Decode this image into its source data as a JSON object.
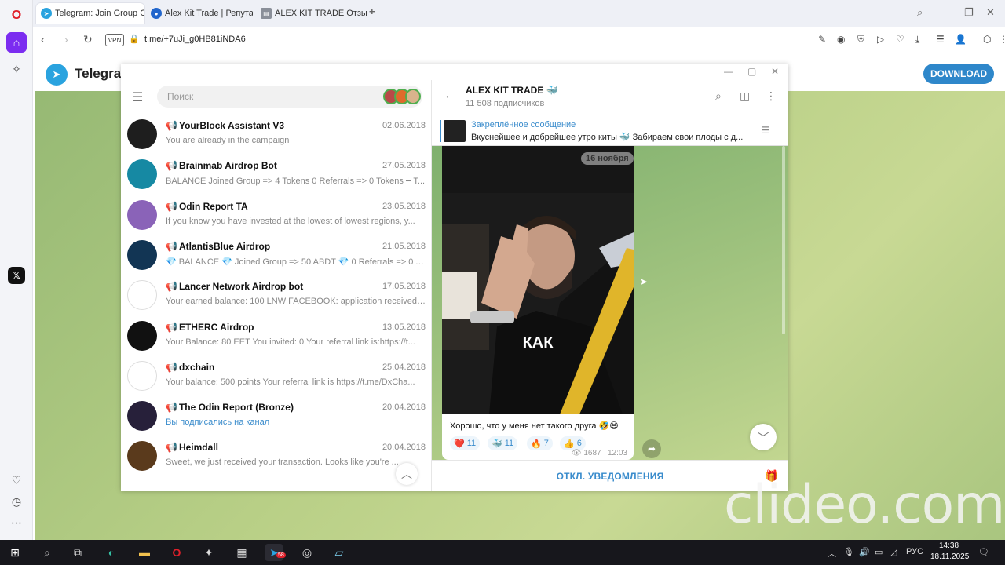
{
  "browser": {
    "tabs": [
      {
        "label": "Telegram: Join Group Chat",
        "icon": "telegram-icon",
        "active": true
      },
      {
        "label": "Alex Kit Trade | Репутация",
        "icon": "site-icon",
        "active": false
      },
      {
        "label": "ALEX KIT TRADE Отзывы",
        "icon": "document-icon",
        "active": false
      }
    ],
    "new_tab": "+",
    "url": "t.me/+7uJi_g0HB81iNDA6",
    "vpn_label": "VPN"
  },
  "tg_web": {
    "title": "Telegra",
    "download_label": "DOWNLOAD"
  },
  "left_panel": {
    "search_placeholder": "Поиск",
    "chats": [
      {
        "kind": "📢",
        "name": "YourBlock Assistant V3",
        "date": "02.06.2018",
        "preview": "You are already in the campaign",
        "avatar_color": "#1e1e1e"
      },
      {
        "kind": "📢",
        "name": "Brainmab Airdrop Bot",
        "date": "27.05.2018",
        "preview": "BALANCE  Joined Group => 4 Tokens 0 Referrals => 0 Tokens  ━ T...",
        "avatar_color": "#1689a3"
      },
      {
        "kind": "📢",
        "name": "Odin Report TA",
        "date": "23.05.2018",
        "preview": "If you know you have invested at the lowest of lowest regions, y...",
        "avatar_color": "#8a63b8"
      },
      {
        "kind": "📢",
        "name": "AtlantisBlue Airdrop",
        "date": "21.05.2018",
        "preview": "💎 BALANCE  💎 Joined Group => 50 ABDT 💎 0 Referrals => 0 A...",
        "avatar_color": "#123554"
      },
      {
        "kind": "📢",
        "name": "Lancer Network Airdrop bot",
        "date": "17.05.2018",
        "preview": "Your earned balance: 100 LNW  FACEBOOK: application received,...",
        "avatar_color": "#ffffff"
      },
      {
        "kind": "📢",
        "name": "ETHERC Airdrop",
        "date": "13.05.2018",
        "preview": "Your Balance:  80 EET You invited: 0  Your referral link is:https://t...",
        "avatar_color": "#111111"
      },
      {
        "kind": "📢",
        "name": "dxchain",
        "date": "25.04.2018",
        "preview": "Your balance: 500 points Your referral link is https://t.me/DxCha...",
        "avatar_color": "#ffffff"
      },
      {
        "kind": "📢",
        "name": "The Odin Report (Bronze)",
        "date": "20.04.2018",
        "preview": "Вы подписались на канал",
        "avatar_color": "#27203a"
      },
      {
        "kind": "📢",
        "name": "Heimdall",
        "date": "20.04.2018",
        "preview": "Sweet, we just received your transaction. Looks like you're ...",
        "avatar_color": "#5a3a1c"
      }
    ]
  },
  "channel": {
    "title": "ALEX KIT TRADE 🐳",
    "subscribers": "11 508 подписчиков",
    "pinned_title": "Закреплённое сообщение",
    "pinned_text": "Вкуснейшее и добрейшее утро киты 🐳 Забираем свои плоды с д...",
    "date_chip": "16 ноября",
    "video_caption": "КАК",
    "message_text": "Хорошо, что у меня нет такого друга 🤣😆",
    "reactions": [
      {
        "emoji": "❤️",
        "count": "11"
      },
      {
        "emoji": "🐳",
        "count": "11"
      },
      {
        "emoji": "🔥",
        "count": "7"
      },
      {
        "emoji": "👍",
        "count": "6"
      }
    ],
    "views": "1687",
    "time": "12:03",
    "mute_label": "ОТКЛ. УВЕДОМЛЕНИЯ"
  },
  "watermark": "clideo.com",
  "taskbar": {
    "language": "РУС",
    "time": "14:38",
    "date": "18.11.2025",
    "telegram_badge": "58"
  }
}
